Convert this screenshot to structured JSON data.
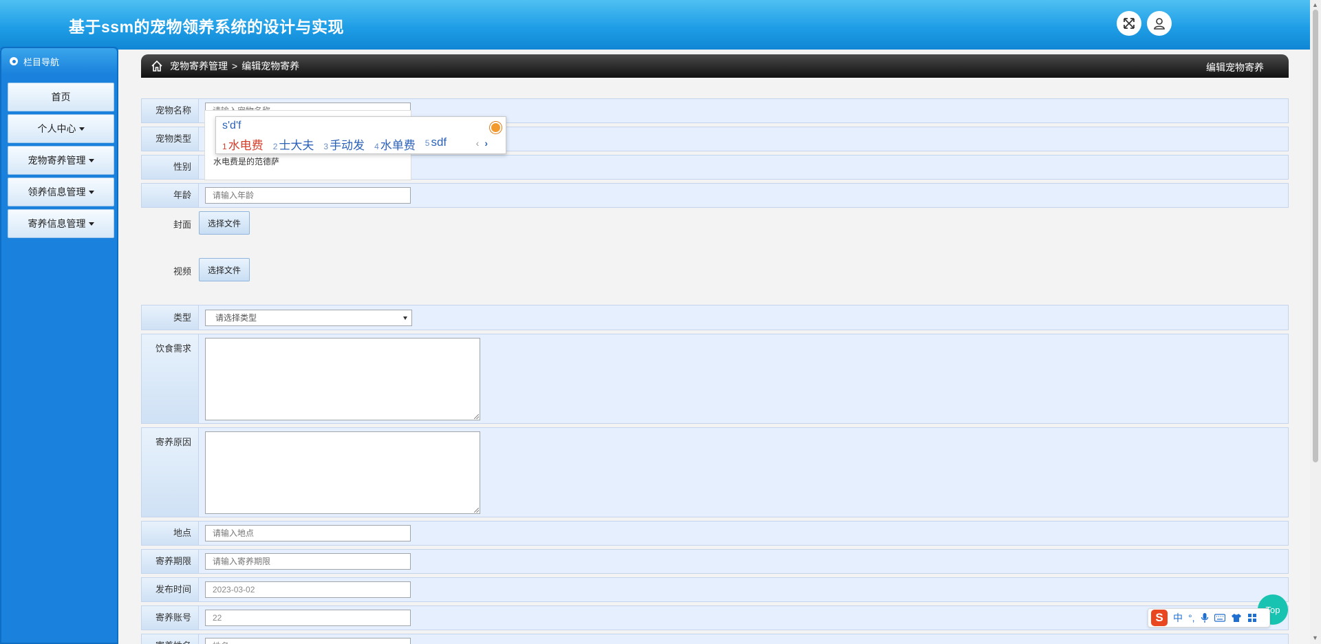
{
  "app": {
    "title": "基于ssm的宠物领养系统的设计与实现"
  },
  "header_icons": [
    "fullscreen-icon",
    "user-icon"
  ],
  "sidebar": {
    "heading": "栏目导航",
    "items": [
      {
        "label": "首页",
        "has_caret": false
      },
      {
        "label": "个人中心",
        "has_caret": true
      },
      {
        "label": "宠物寄养管理",
        "has_caret": true
      },
      {
        "label": "领养信息管理",
        "has_caret": true
      },
      {
        "label": "寄养信息管理",
        "has_caret": true
      }
    ]
  },
  "breadcrumb": {
    "section": "宠物寄养管理",
    "separator": ">",
    "page": "编辑宠物寄养",
    "right_title": "编辑宠物寄养"
  },
  "form": {
    "pet_name": {
      "label": "宠物名称",
      "placeholder": "请输入宠物名称"
    },
    "pet_type": {
      "label": "宠物类型"
    },
    "gender": {
      "label": "性别"
    },
    "dropdown_suggestion": "水电费是的范德萨",
    "age": {
      "label": "年龄",
      "placeholder": "请输入年龄"
    },
    "cover": {
      "label": "封面",
      "button": "选择文件"
    },
    "video": {
      "label": "视频",
      "button": "选择文件"
    },
    "category": {
      "label": "类型",
      "selected": "请选择类型"
    },
    "diet": {
      "label": "饮食需求"
    },
    "reason": {
      "label": "寄养原因"
    },
    "location": {
      "label": "地点",
      "placeholder": "请输入地点"
    },
    "period": {
      "label": "寄养期限",
      "placeholder": "请输入寄养期限"
    },
    "publish_time": {
      "label": "发布时间",
      "value": "2023-03-02"
    },
    "account": {
      "label": "寄养账号",
      "value": "22"
    },
    "next_row": {
      "label": "寄养姓名",
      "value": "姓名"
    }
  },
  "ime": {
    "pinyin": "s'd'f",
    "candidates": [
      {
        "num": "1",
        "text": "水电费"
      },
      {
        "num": "2",
        "text": "士大夫"
      },
      {
        "num": "3",
        "text": "手动发"
      },
      {
        "num": "4",
        "text": "水单费"
      },
      {
        "num": "5",
        "text": "sdf"
      }
    ],
    "prev": "‹",
    "next": "›"
  },
  "toolbar_ime": {
    "logo": "S",
    "mode": "中",
    "punct": "°,",
    "icons": [
      "mic-icon",
      "keyboard-icon",
      "shirt-icon",
      "grid-icon"
    ]
  },
  "top_button": "Top",
  "colors": {
    "header": "#1f9ee6",
    "sidebar": "#1a82dc",
    "row_bg": "#e5effd",
    "ime_first": "#d43d2a"
  }
}
